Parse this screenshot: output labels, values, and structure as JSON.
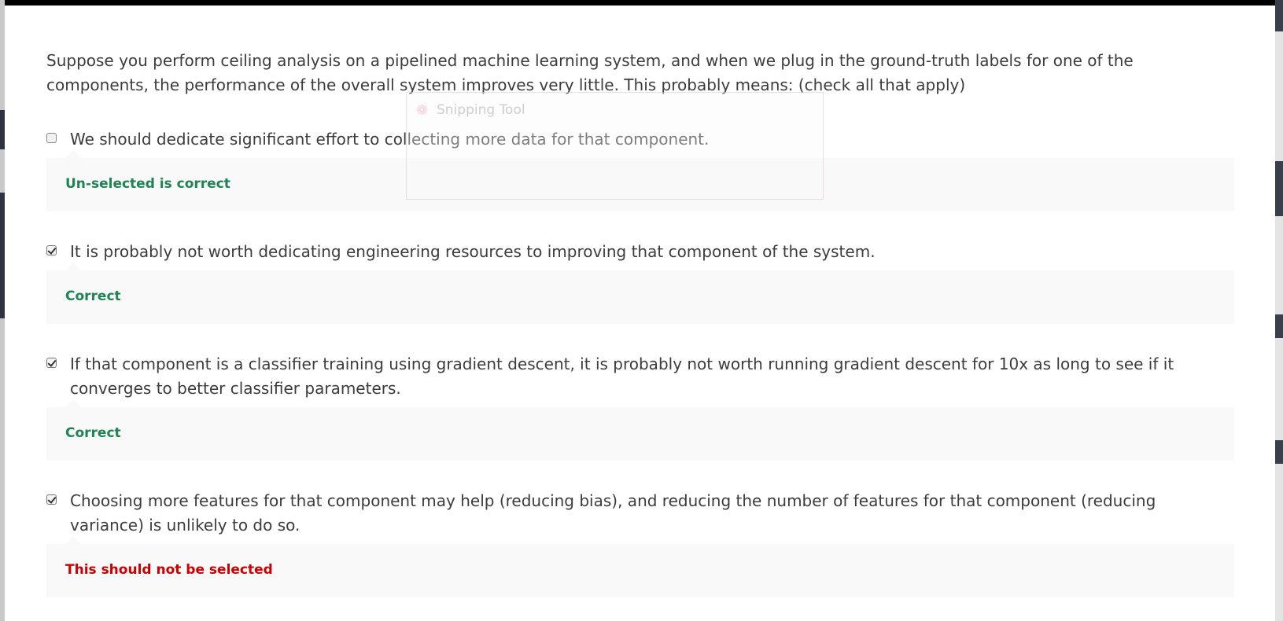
{
  "question": "Suppose you perform ceiling analysis on a pipelined machine learning system, and when we plug in the ground-truth labels for one of the components, the performance of the overall system improves very little. This probably means: (check all that apply)",
  "options": [
    {
      "text": "We should dedicate significant effort to collecting more data for that component.",
      "checked": false,
      "feedback": "Un-selected is correct",
      "feedback_color": "#1f8354"
    },
    {
      "text": "It is probably not worth dedicating engineering resources to improving that component of the system.",
      "checked": true,
      "feedback": "Correct",
      "feedback_color": "#1f8354"
    },
    {
      "text": "If that component is a classifier training using gradient descent, it is probably not worth running gradient descent for 10x as long to see if it converges to better classifier parameters.",
      "checked": true,
      "feedback": "Correct",
      "feedback_color": "#1f8354"
    },
    {
      "text": "Choosing more features for that component may help (reducing bias), and reducing the number of features for that component (reducing variance) is unlikely to do so.",
      "checked": true,
      "feedback": "This should not be selected",
      "feedback_color": "#cc0000"
    }
  ],
  "overlay": {
    "title": "Snipping Tool",
    "icon": "snipping-tool-icon"
  },
  "colors": {
    "correct": "#1f8354",
    "incorrect": "#cc0000",
    "text": "#3c3c3c",
    "feedback_bg": "#f9f9f9"
  }
}
